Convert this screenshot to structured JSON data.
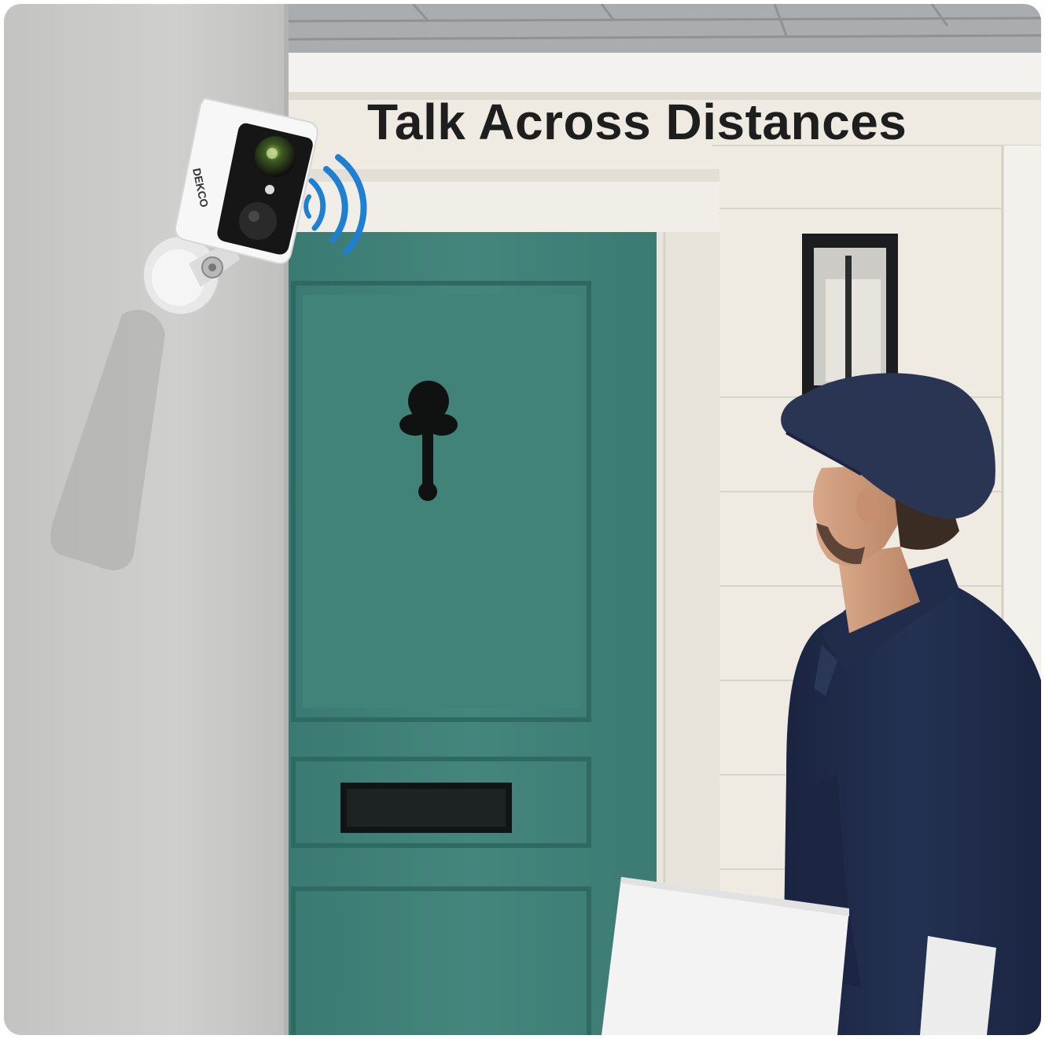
{
  "headline": "Talk Across Distances",
  "camera": {
    "brand_text": "DEKCO"
  },
  "colors": {
    "wall": "#c9c9c7",
    "door": "#3e7f77",
    "door_frame": "#ebe7de",
    "siding": "#ece8df",
    "uniform": "#1f2a47",
    "signal_waves": "#1f7fd0",
    "headline": "#1e1e1e"
  },
  "icons": [
    "camera-icon",
    "sound-wave-icon"
  ]
}
